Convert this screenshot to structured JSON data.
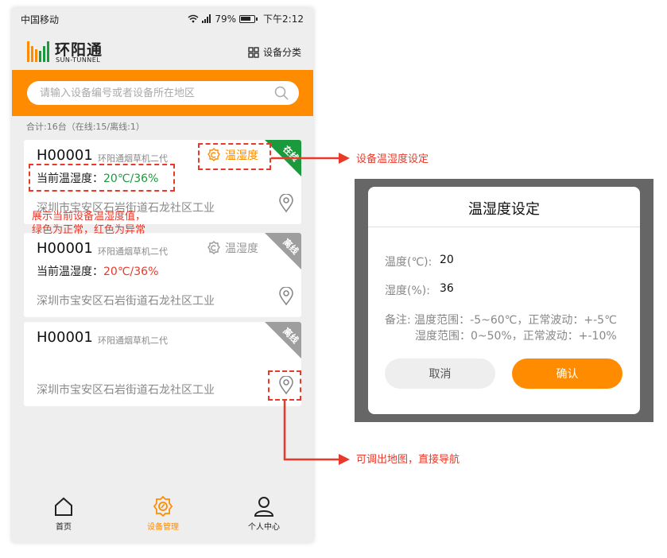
{
  "status_bar": {
    "carrier": "中国移动",
    "battery": "79%",
    "time": "下午2:12"
  },
  "header": {
    "app_name": "环阳通",
    "app_subtitle": "SUN-TUNNEL",
    "category_label": "设备分类"
  },
  "search": {
    "placeholder": "请输入设备编号或者设备所在地区"
  },
  "summary": "合计:16台（在线:15/离线:1）",
  "devices": [
    {
      "id": "H00001",
      "model": "环阳通烟草机二代",
      "th_label": "温湿度",
      "temp_label": "当前温湿度：",
      "temp_value": "20℃/36%",
      "address": "深圳市宝安区石岩街道石龙社区工业",
      "status": "在线"
    },
    {
      "id": "H00001",
      "model": "环阳通烟草机二代",
      "th_label": "温湿度",
      "temp_label": "当前温湿度：",
      "temp_value": "20℃/36%",
      "address": "深圳市宝安区石岩街道石龙社区工业",
      "status": "离线"
    },
    {
      "id": "H00001",
      "model": "环阳通烟草机二代",
      "address": "深圳市宝安区石岩街道石龙社区工业",
      "status": "离线"
    }
  ],
  "tabs": [
    {
      "label": "首页"
    },
    {
      "label": "设备管理"
    },
    {
      "label": "个人中心"
    }
  ],
  "annotations": {
    "th_setting": "设备温湿度设定",
    "temp_note_line1": "展示当前设备温湿度值，",
    "temp_note_line2": "绿色为正常，红色为异常",
    "map_note": "可调出地图，直接导航"
  },
  "dialog": {
    "title": "温湿度设定",
    "temp_label": "温度(℃):",
    "temp_value": "20",
    "humidity_label": "湿度(%):",
    "humidity_value": "36",
    "remark_line1": "备注: 温度范围：-5~60℃，正常波动：+-5℃",
    "remark_line2": "湿度范围：0~50%，正常波动：+-10%",
    "cancel_label": "取消",
    "confirm_label": "确认"
  },
  "colors": {
    "brand_orange": "#ff8c00",
    "online_green": "#1a9a3c",
    "offline_gray": "#9e9e9e",
    "normal_text": "#1a9a3c",
    "abnormal_text": "#e8392a",
    "annotation_red": "#e8392a"
  }
}
